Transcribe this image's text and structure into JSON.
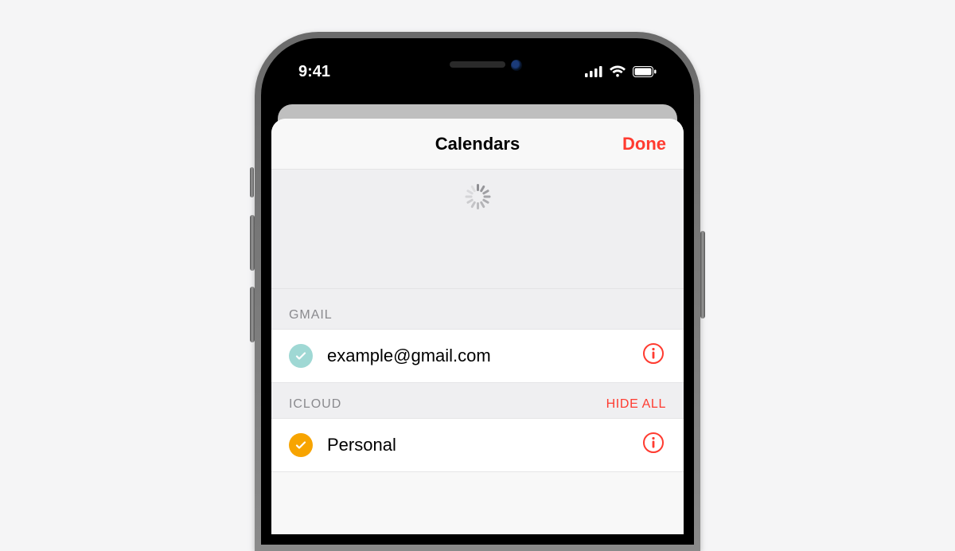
{
  "status": {
    "time": "9:41"
  },
  "modal": {
    "title": "Calendars",
    "done_label": "Done"
  },
  "sections": [
    {
      "header": "GMAIL",
      "hide_all_label": null,
      "items": [
        {
          "label": "example@gmail.com",
          "checked": true,
          "color": "#9fd8d4"
        }
      ]
    },
    {
      "header": "ICLOUD",
      "hide_all_label": "HIDE ALL",
      "items": [
        {
          "label": "Personal",
          "checked": true,
          "color": "#f7a400"
        }
      ]
    }
  ],
  "colors": {
    "accent": "#ff3b30"
  }
}
